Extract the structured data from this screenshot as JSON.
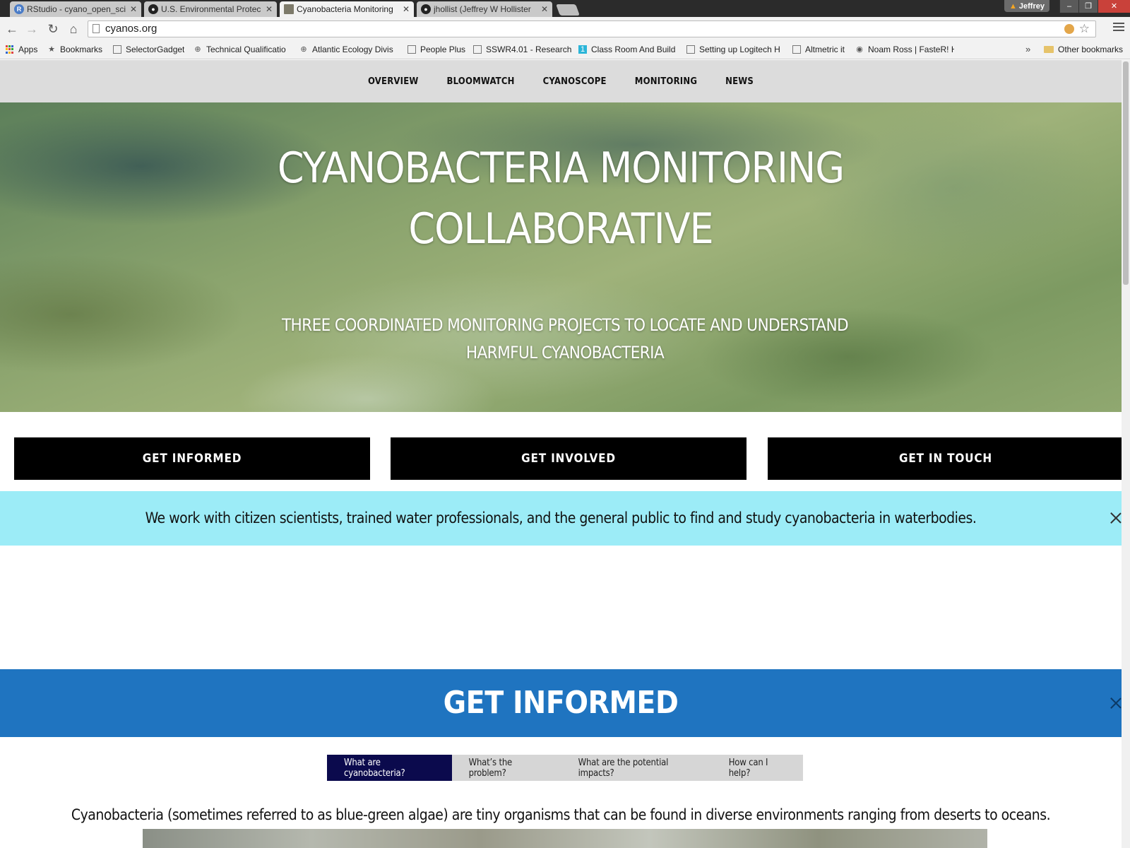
{
  "browser": {
    "tabs": [
      {
        "title": "RStudio - cyano_open_sci",
        "icon_color": "#4a7cc7",
        "active": false
      },
      {
        "title": "U.S. Environmental Protec",
        "icon_color": "#222222",
        "active": false
      },
      {
        "title": "Cyanobacteria Monitoring",
        "icon_color": "#7d7a6a",
        "active": true
      },
      {
        "title": "jhollist (Jeffrey W Hollister",
        "icon_color": "#222222",
        "active": false
      }
    ],
    "user": "Jeffrey",
    "url": "cyanos.org",
    "bookmarks": [
      {
        "label": "Apps",
        "icon": "apps-icon"
      },
      {
        "label": "Bookmarks",
        "icon": "star-icon"
      },
      {
        "label": "SelectorGadget",
        "icon": "page-icon"
      },
      {
        "label": "Technical Qualificatio",
        "icon": "globe-icon"
      },
      {
        "label": "Atlantic Ecology Divis",
        "icon": "globe-icon"
      },
      {
        "label": "People Plus",
        "icon": "page-icon"
      },
      {
        "label": "SSWR4.01 - Research",
        "icon": "page-icon"
      },
      {
        "label": "Class Room And Build",
        "icon": "calendar-icon"
      },
      {
        "label": "Setting up Logitech H",
        "icon": "page-icon"
      },
      {
        "label": "Altmetric it",
        "icon": "page-icon"
      },
      {
        "label": "Noam Ross | FasteR! H",
        "icon": "github-icon"
      }
    ],
    "overflow": "»",
    "other_bookmarks": "Other bookmarks"
  },
  "site": {
    "nav": [
      "OVERVIEW",
      "BLOOMWATCH",
      "CYANOSCOPE",
      "MONITORING",
      "NEWS"
    ],
    "hero_title_line1": "CYANOBACTERIA MONITORING",
    "hero_title_line2": "COLLABORATIVE",
    "hero_subtitle": "THREE COORDINATED MONITORING PROJECTS TO LOCATE AND UNDERSTAND HARMFUL CYANOBACTERIA",
    "cta": [
      "GET INFORMED",
      "GET INVOLVED",
      "GET IN TOUCH"
    ],
    "notice": "We work with citizen scientists, trained water professionals, and the general public to find and study cyanobacteria in waterbodies.",
    "section_title": "GET INFORMED",
    "subtabs": [
      "What are cyanobacteria?",
      "What’s the problem?",
      "What are the potential impacts?",
      "How can I help?"
    ],
    "active_subtab": "What are cyanobacteria?",
    "intro": "Cyanobacteria (sometimes referred to as blue-green algae) are tiny organisms that can be found in diverse environments ranging from deserts to oceans."
  },
  "colors": {
    "nav_bg": "#dcdcdc",
    "cta_bg": "#000000",
    "notice_bg": "#9cecf7",
    "section_band": "#1f74c0",
    "active_subtab": "#0b0a4d"
  }
}
